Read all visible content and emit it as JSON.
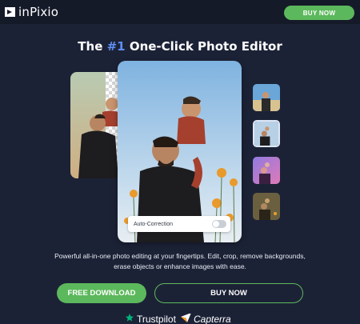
{
  "header": {
    "logo_text": "inPixio",
    "buy_label": "BUY NOW"
  },
  "hero": {
    "title_prefix": "The ",
    "title_accent": "#1",
    "title_suffix": " One-Click Photo Editor"
  },
  "editor": {
    "toggle_label": "Auto-Correction",
    "toggle_on": false
  },
  "description": "Powerful all-in-one photo editing at your fingertips. Edit, crop, remove backgrounds, erase objects or enhance images with ease.",
  "cta": {
    "download_label": "FREE DOWNLOAD",
    "buy_label": "BUY NOW"
  },
  "badges": {
    "trustpilot": "Trustpilot",
    "capterra": "Capterra"
  },
  "colors": {
    "background": "#1c2236",
    "accent_green": "#5cb85c",
    "accent_blue": "#5e8df2"
  }
}
